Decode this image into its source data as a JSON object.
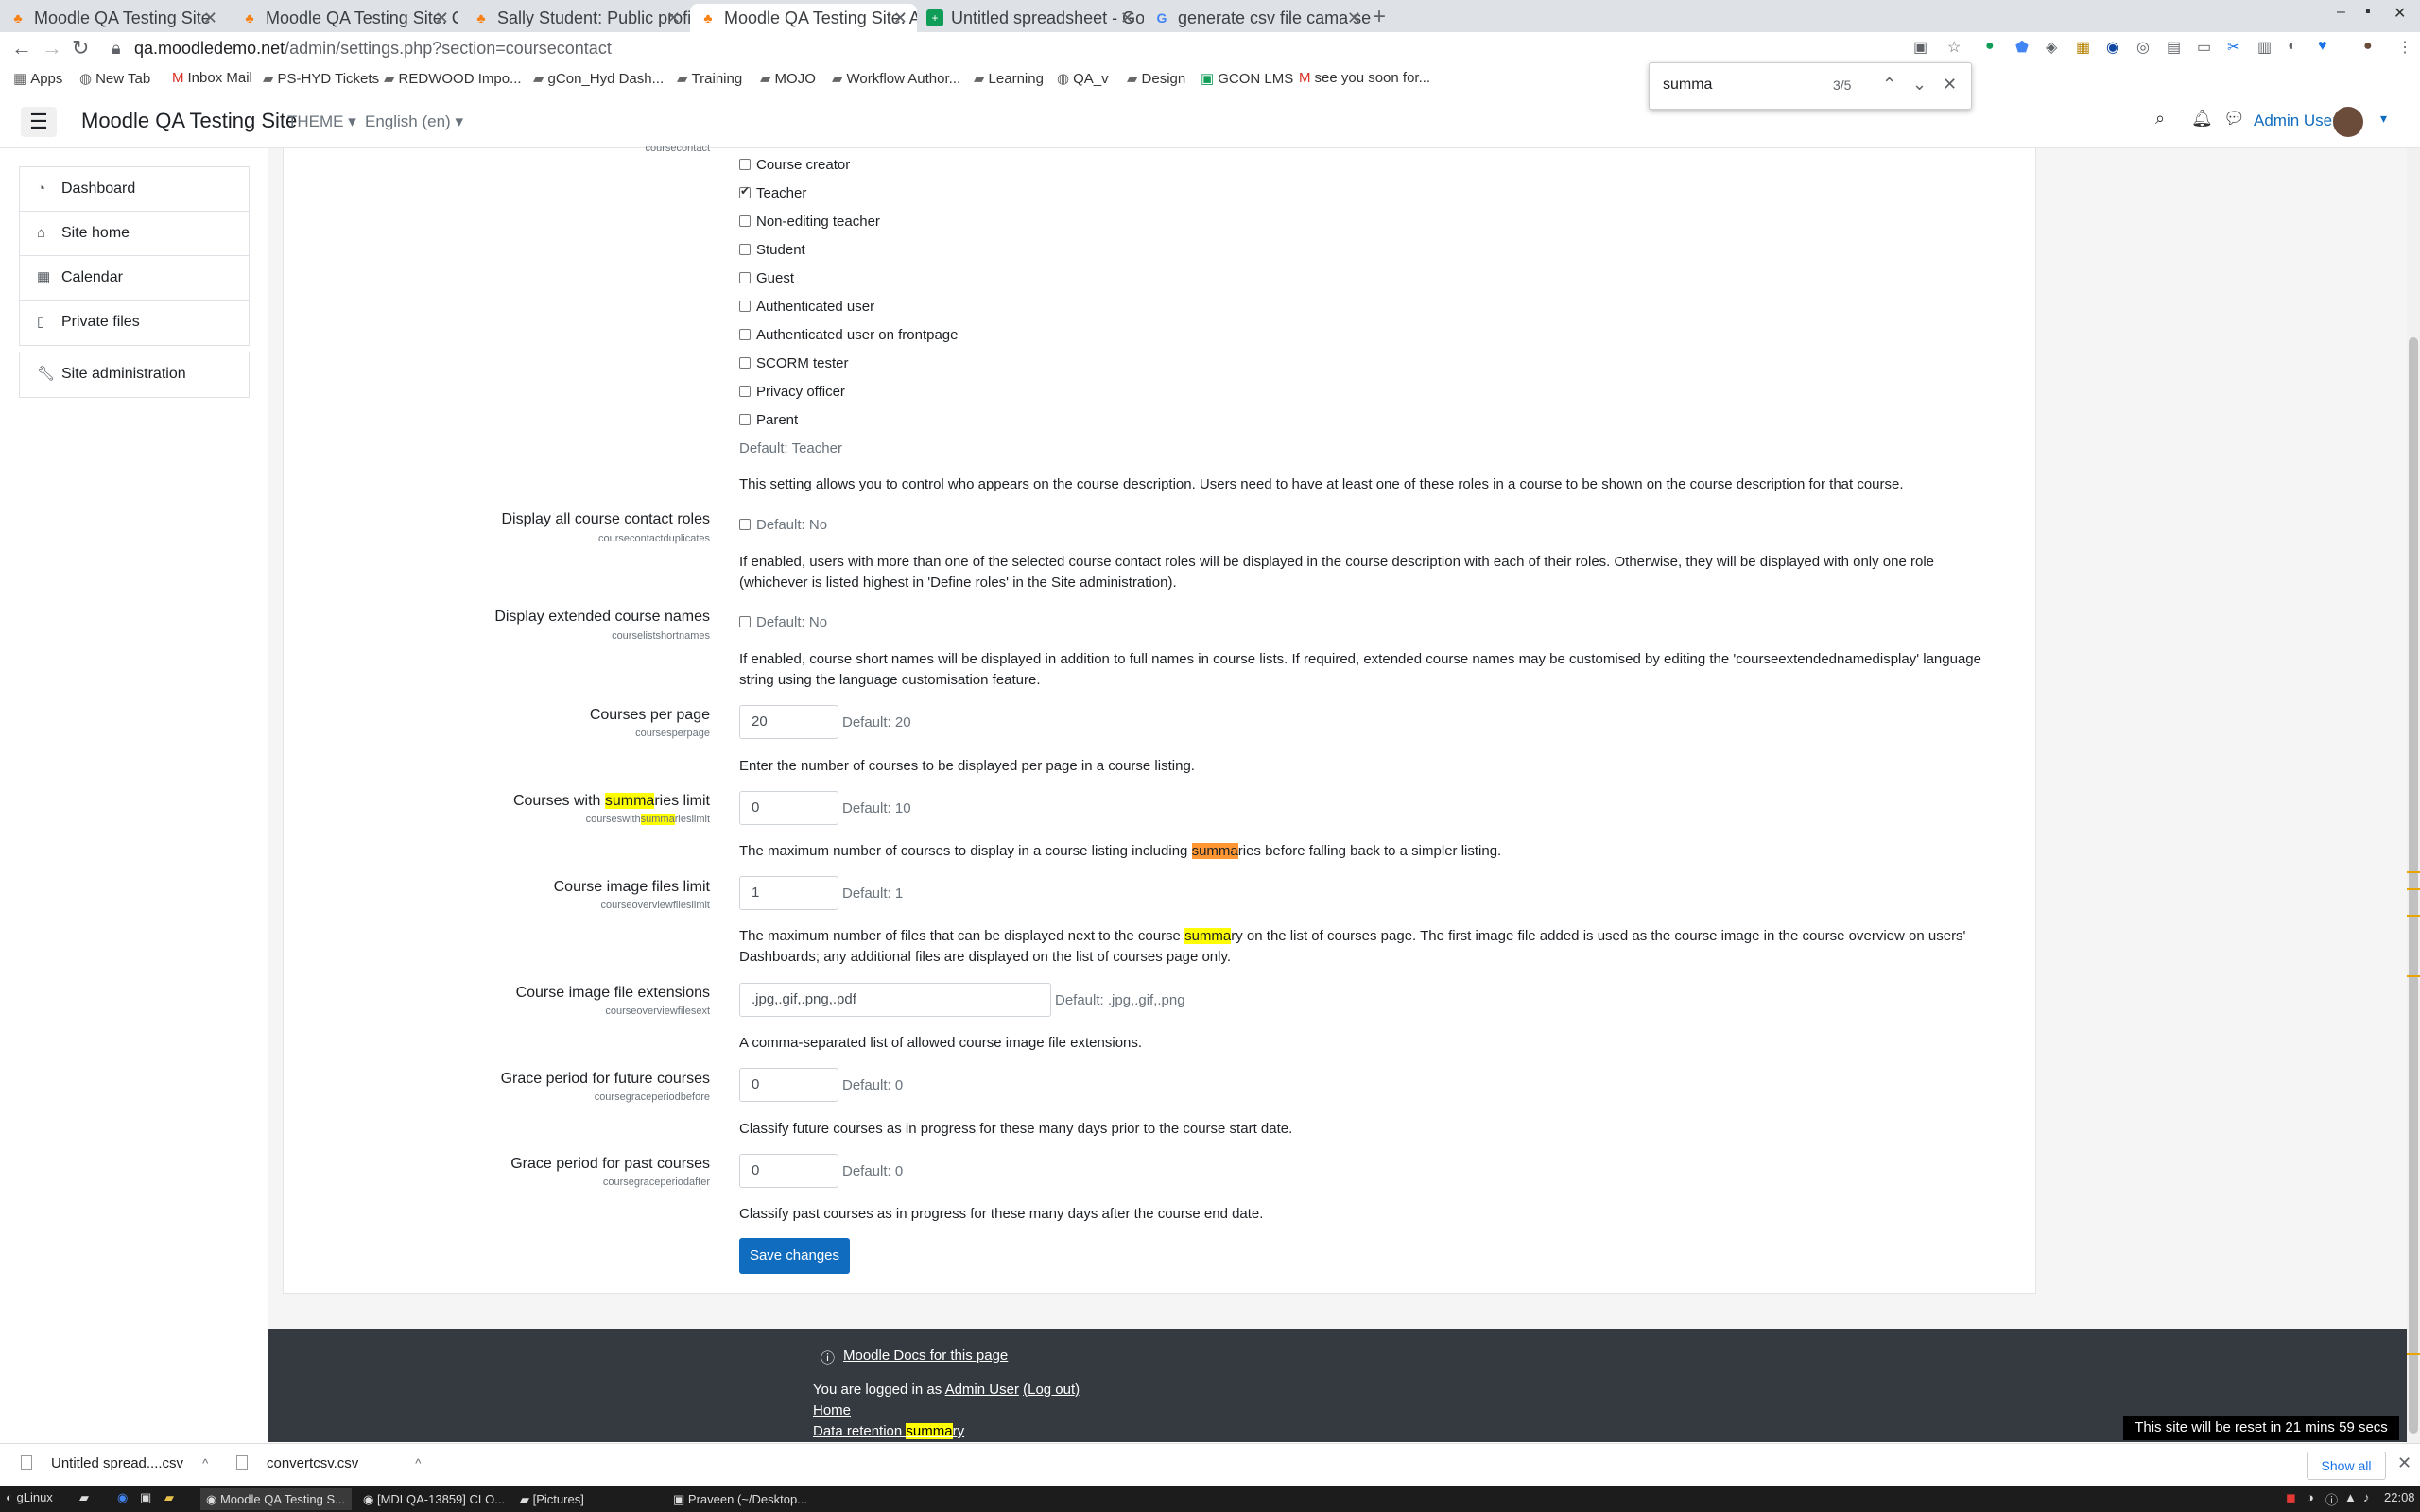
{
  "browser": {
    "tabs": [
      {
        "title": "Moodle QA Testing Site",
        "active": false
      },
      {
        "title": "Moodle QA Testing Site: Cale",
        "active": false
      },
      {
        "title": "Sally Student: Public profile",
        "active": false
      },
      {
        "title": "Moodle QA Testing Site: Adm",
        "active": true
      },
      {
        "title": "Untitled spreadsheet - Googl",
        "active": false
      },
      {
        "title": "generate csv file cama separ",
        "active": false
      }
    ],
    "url_host": "qa.moodledemo.net",
    "url_path": "/admin/settings.php?section=coursecontact",
    "bookmarks": [
      "Apps",
      "New Tab",
      "Inbox Mail",
      "PS-HYD Tickets",
      "REDWOOD Impo...",
      "gCon_Hyd Dash...",
      "Training",
      "MOJO",
      "Workflow Author...",
      "Learning",
      "QA_v",
      "Design",
      "GCON LMS",
      "see you soon for..."
    ],
    "find": {
      "query": "summa",
      "count": "3/5"
    }
  },
  "navbar": {
    "brand": "Moodle QA Testing Site",
    "theme": "THEME",
    "language": "English (en)",
    "user": "Admin User"
  },
  "drawer": {
    "items": [
      "Dashboard",
      "Site home",
      "Calendar",
      "Private files"
    ],
    "admin": "Site administration"
  },
  "settings": {
    "coursecontact_sub": "coursecontact",
    "roles": [
      {
        "label": "Course creator",
        "checked": false
      },
      {
        "label": "Teacher",
        "checked": true
      },
      {
        "label": "Non-editing teacher",
        "checked": false
      },
      {
        "label": "Student",
        "checked": false
      },
      {
        "label": "Guest",
        "checked": false
      },
      {
        "label": "Authenticated user",
        "checked": false
      },
      {
        "label": "Authenticated user on frontpage",
        "checked": false
      },
      {
        "label": "SCORM tester",
        "checked": false
      },
      {
        "label": "Privacy officer",
        "checked": false
      },
      {
        "label": "Parent",
        "checked": false
      }
    ],
    "roles_default": "Default: Teacher",
    "roles_desc": "This setting allows you to control who appears on the course description. Users need to have at least one of these roles in a course to be shown on the course description for that course.",
    "dup_label": "Display all course contact roles",
    "dup_sub": "coursecontactduplicates",
    "dup_default": "Default: No",
    "dup_desc": "If enabled, users with more than one of the selected course contact roles will be displayed in the course description with each of their roles. Otherwise, they will be displayed with only one role (whichever is listed highest in 'Define roles' in the Site administration).",
    "ext_label": "Display extended course names",
    "ext_sub": "courselistshortnames",
    "ext_default": "Default: No",
    "ext_desc": "If enabled, course short names will be displayed in addition to full names in course lists. If required, extended course names may be customised by editing the 'courseextendednamedisplay' language string using the language customisation feature.",
    "perpage_label": "Courses per page",
    "perpage_sub": "coursesperpage",
    "perpage_value": "20",
    "perpage_default": "Default: 20",
    "perpage_desc": "Enter the number of courses to be displayed per page in a course listing.",
    "summ_label_pre": "Courses with ",
    "summ_label_hl": "summa",
    "summ_label_post": "ries limit",
    "summ_sub_pre": "courseswith",
    "summ_sub_hl": "summa",
    "summ_sub_post": "rieslimit",
    "summ_value": "0",
    "summ_default": "Default: 10",
    "summ_desc_pre": "The maximum number of courses to display in a course listing including ",
    "summ_desc_hl": "summa",
    "summ_desc_post": "ries before falling back to a simpler listing.",
    "img_label": "Course image files limit",
    "img_sub": "courseoverviewfileslimit",
    "img_value": "1",
    "img_default": "Default: 1",
    "img_desc_pre": "The maximum number of files that can be displayed next to the course ",
    "img_desc_hl": "summa",
    "img_desc_post": "ry on the list of courses page. The first image file added is used as the course image in the course overview on users' Dashboards; any additional files are displayed on the list of courses page only.",
    "ext2_label": "Course image file extensions",
    "ext2_sub": "courseoverviewfilesext",
    "ext2_value": ".jpg,.gif,.png,.pdf",
    "ext2_default": "Default: .jpg,.gif,.png",
    "ext2_desc": "A comma-separated list of allowed course image file extensions.",
    "gfut_label": "Grace period for future courses",
    "gfut_sub": "coursegraceperiodbefore",
    "gfut_value": "0",
    "gfut_default": "Default: 0",
    "gfut_desc": "Classify future courses as in progress for these many days prior to the course start date.",
    "gpast_label": "Grace period for past courses",
    "gpast_sub": "coursegraceperiodafter",
    "gpast_value": "0",
    "gpast_default": "Default: 0",
    "gpast_desc": "Classify past courses as in progress for these many days after the course end date.",
    "save": "Save changes"
  },
  "footer": {
    "docs": "Moodle Docs for this page",
    "logged_pre": "You are logged in as ",
    "logged_user": "Admin User",
    "logout": "(Log out)",
    "home": "Home",
    "retention_pre": "Data retention ",
    "retention_hl": "summa",
    "retention_post": "ry",
    "reset": "This site will be reset in 21 mins 59 secs"
  },
  "downloads": {
    "items": [
      "Untitled spread....csv",
      "convertcsv.csv"
    ],
    "show_all": "Show all"
  },
  "taskbar": {
    "start": "gLinux",
    "tasks": [
      "Moodle QA Testing S...",
      "[MDLQA-13859] CLO...",
      "[Pictures]",
      "Praveen (~/Desktop..."
    ],
    "time": "22:08"
  }
}
